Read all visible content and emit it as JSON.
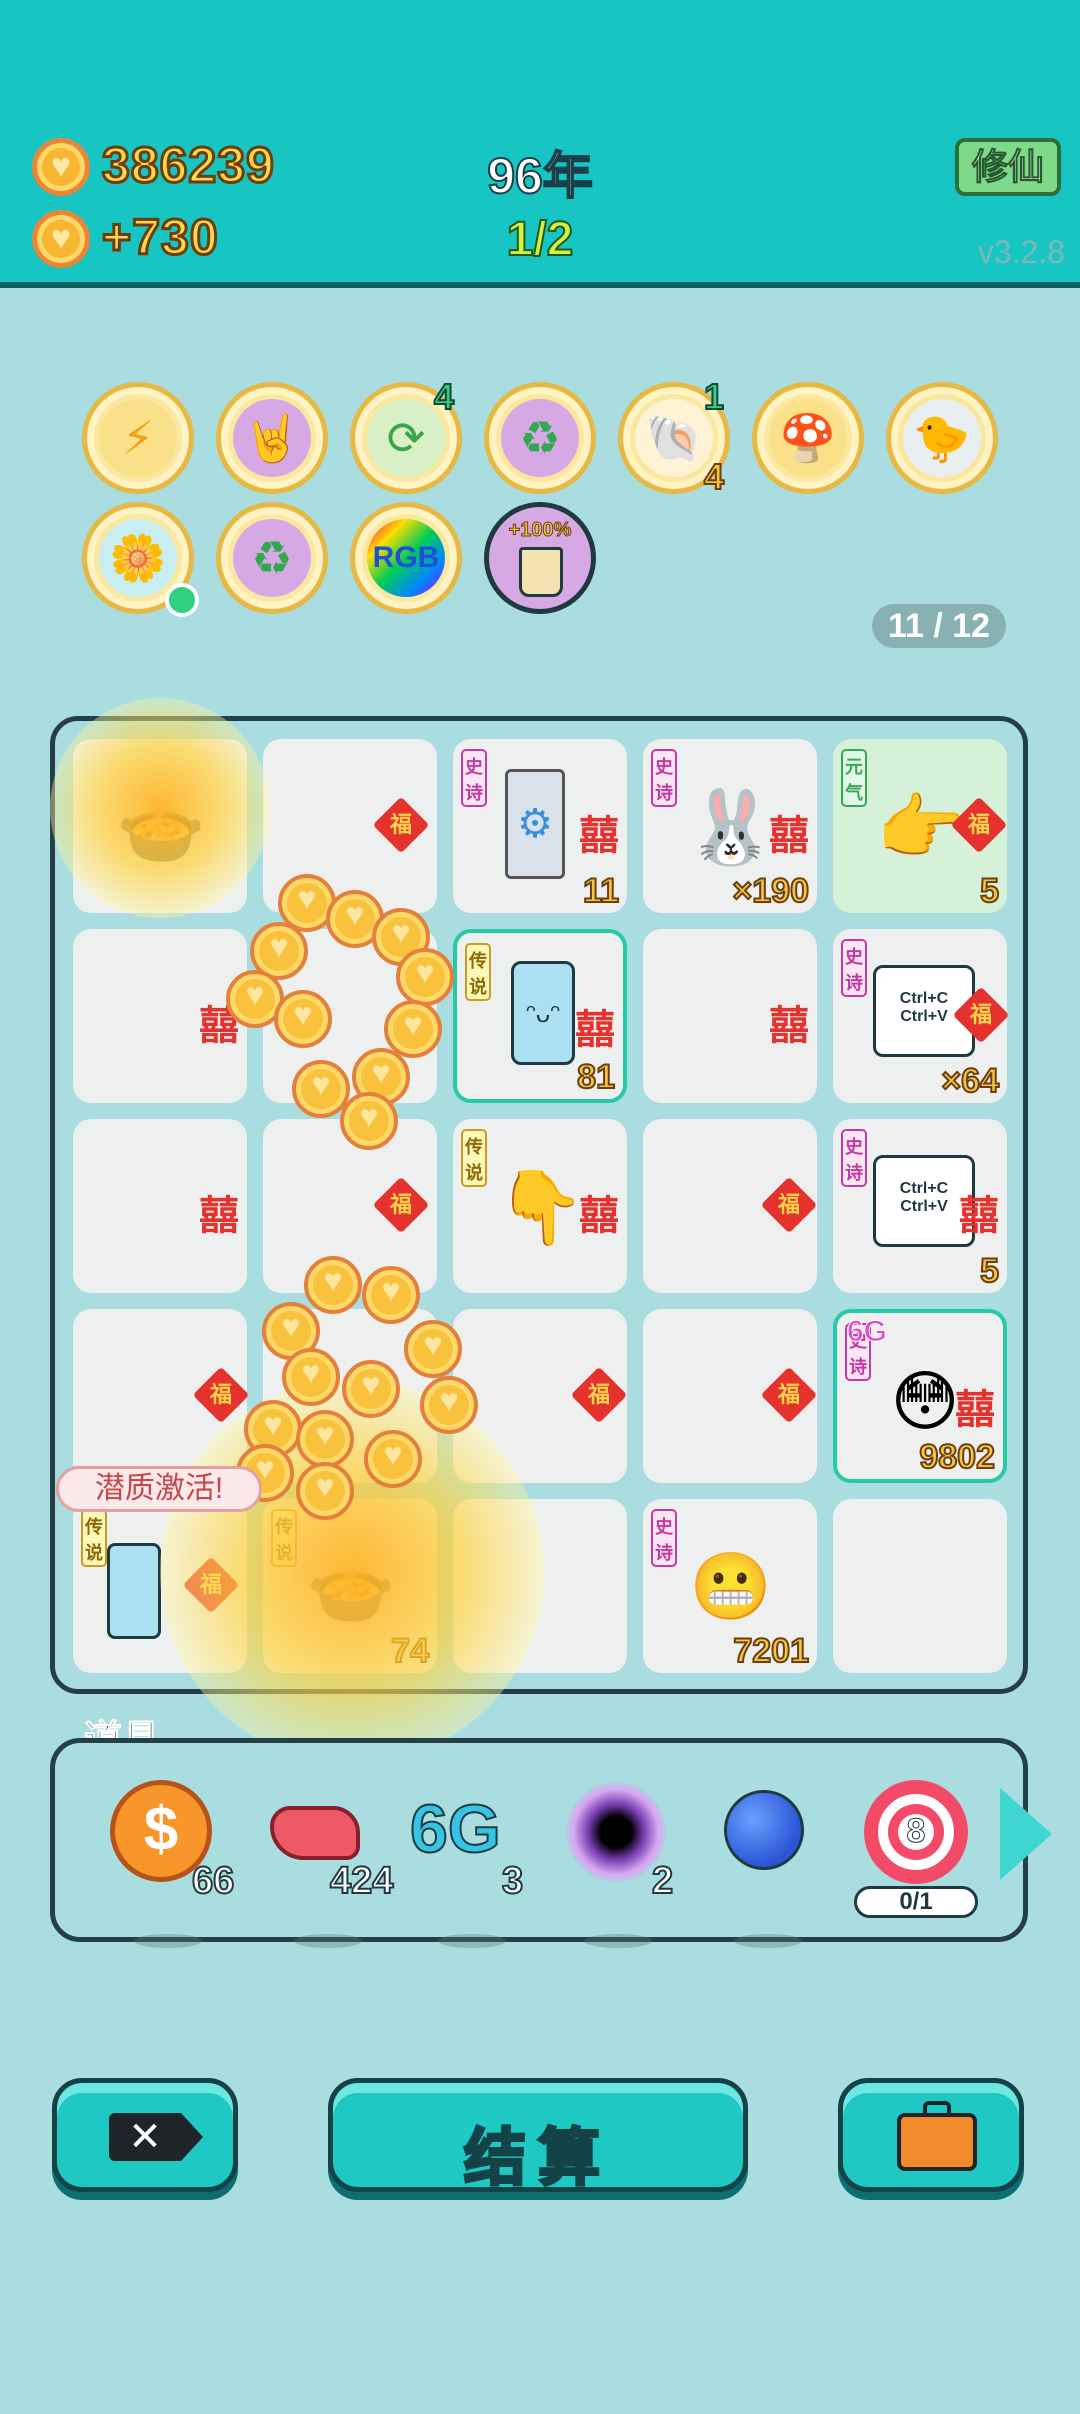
{
  "header": {
    "coins": "386239",
    "income": "+730",
    "year": "96年",
    "round": "1/2",
    "cultivate_label": "修仙",
    "version": "v3.2.8"
  },
  "buffs": [
    {
      "icon": "lightning-icon",
      "count": ""
    },
    {
      "icon": "rock-hand-icon",
      "count": ""
    },
    {
      "icon": "refresh-icon",
      "count": "4"
    },
    {
      "icon": "recycle-icon",
      "count": ""
    },
    {
      "icon": "shell-icon",
      "count_top": "1",
      "count_bottom": "4"
    },
    {
      "icon": "mushroom-cloud-icon",
      "count": ""
    },
    {
      "icon": "pot-duck-icon",
      "count": ""
    },
    {
      "icon": "flower-pot-icon",
      "count": ""
    },
    {
      "icon": "recycle-icon",
      "count": ""
    },
    {
      "icon": "rgb-icon",
      "text": "RGB"
    },
    {
      "icon": "milk-tea-icon",
      "text": "+100%"
    }
  ],
  "page_counter": "11 / 12",
  "board": {
    "tags": {
      "epic": "史诗",
      "legend": "传说",
      "green": "元气"
    },
    "xi": "囍",
    "fu": "福",
    "cells": [
      {
        "item": "pot-icon",
        "count": ""
      },
      {
        "item": "",
        "count": ""
      },
      {
        "item": "gpu-icon",
        "tag": "epic",
        "count": "11"
      },
      {
        "item": "rabbit-house-icon",
        "tag": "epic",
        "count": "×190"
      },
      {
        "item": "pointing-hand-icon",
        "tag": "green",
        "count": "5"
      },
      {
        "item": "",
        "count": ""
      },
      {
        "item": "",
        "count": ""
      },
      {
        "item": "fridge-icon",
        "tag": "legend",
        "count": "81"
      },
      {
        "item": "",
        "count": ""
      },
      {
        "item": "copy-paste-card-icon",
        "tag": "epic",
        "count": "×64",
        "text": "Ctrl+C\nCtrl+V"
      },
      {
        "item": "",
        "count": ""
      },
      {
        "item": "",
        "count": ""
      },
      {
        "item": "pointing-hand-icon",
        "tag": "legend",
        "count": ""
      },
      {
        "item": "",
        "count": ""
      },
      {
        "item": "copy-paste-card-icon",
        "tag": "epic",
        "count": "5",
        "text": "Ctrl+C\nCtrl+V"
      },
      {
        "item": "",
        "count": ""
      },
      {
        "item": "",
        "count": ""
      },
      {
        "item": "",
        "count": ""
      },
      {
        "item": "",
        "count": ""
      },
      {
        "item": "crowned-face-icon",
        "tag": "epic",
        "count": "9802",
        "badge": "6G"
      },
      {
        "item": "fridge-icon",
        "tag": "legend",
        "count": ""
      },
      {
        "item": "pot-icon",
        "tag": "legend",
        "count": "74"
      },
      {
        "item": "",
        "count": ""
      },
      {
        "item": "face-icon",
        "tag": "epic",
        "count": "7201"
      },
      {
        "item": "",
        "count": ""
      }
    ],
    "bubble": "潜质激活!"
  },
  "props": {
    "label": "道具",
    "items": [
      {
        "icon": "dollar-coin-icon",
        "count": "66"
      },
      {
        "icon": "liver-icon",
        "count": "424"
      },
      {
        "icon": "6g-icon",
        "text": "6G",
        "count": "3"
      },
      {
        "icon": "black-hole-icon",
        "count": "2"
      },
      {
        "icon": "blueberry-icon",
        "count": ""
      },
      {
        "icon": "target-icon",
        "text": "8",
        "count": "0/1"
      }
    ]
  },
  "actions": {
    "settle_label": "结算"
  },
  "colors": {
    "accent": "#17c6c2",
    "gold": "#ffd84d",
    "red": "#e5322f",
    "board": "#a9dde0"
  }
}
